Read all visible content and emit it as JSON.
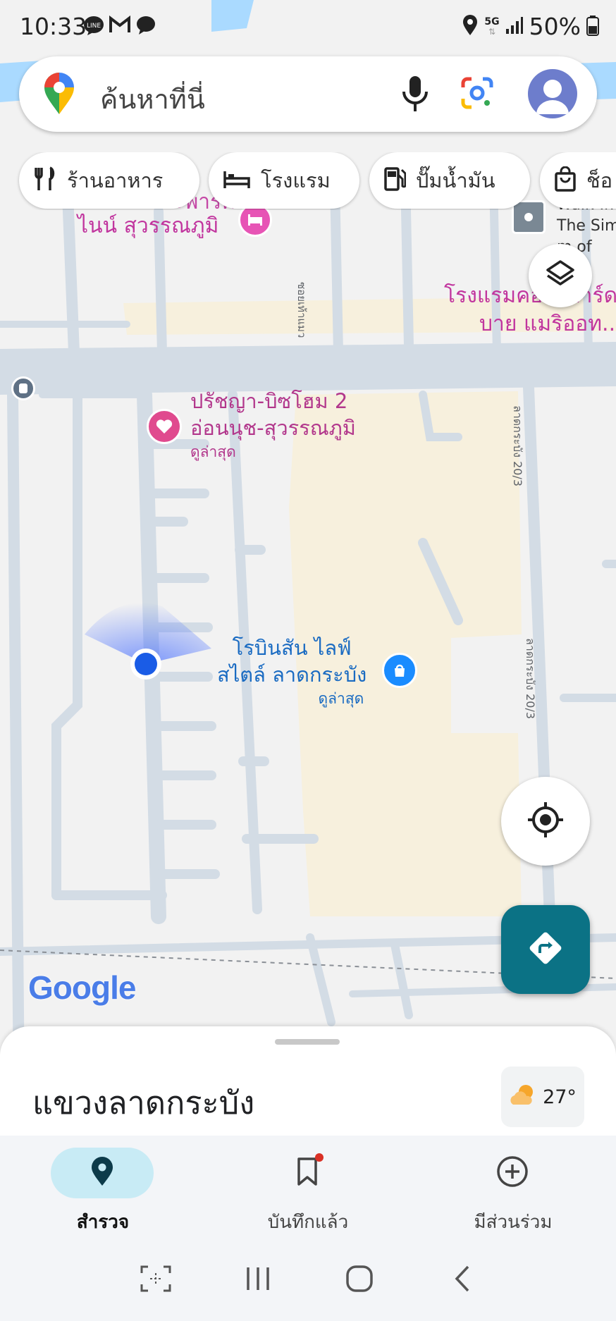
{
  "status_bar": {
    "time": "10:33",
    "battery_percent": "50%",
    "network": "5G",
    "app_icons": [
      "line-icon",
      "gmail-icon",
      "chat-icon"
    ]
  },
  "search": {
    "placeholder": "ค้นหาที่นี่"
  },
  "chips": [
    {
      "label": "ร้านอาหาร",
      "icon": "restaurant-icon"
    },
    {
      "label": "โรงแรม",
      "icon": "hotel-icon"
    },
    {
      "label": "ปั๊มน้ำมัน",
      "icon": "gas-station-icon"
    },
    {
      "label": "ช็อ",
      "icon": "shopping-bag-icon"
    }
  ],
  "map": {
    "place_labels": [
      {
        "line1": "โรงแรม เดอะพาร์ค",
        "line2": "ไนน์ สุวรรณภูมิ",
        "color": "#c1359e"
      },
      {
        "line1": "Walk-In",
        "line2": "The Sim",
        "line3": "m of",
        "color": "#333333"
      },
      {
        "line1": "โรงแรมคอร์ทยาร์ด",
        "line2": "บาย แมริออท...",
        "color": "#c1359e"
      },
      {
        "line1": "ปรัชญา-บิซโฮม 2",
        "line2": "อ่อนนุช-สุวรรณภูมิ",
        "sub": "ดูล่าสุด",
        "color": "#b2378c"
      },
      {
        "line1": "โรบินสัน ไลฟ์",
        "line2": "สไตล์ ลาดกระบัง",
        "sub": "ดูล่าสุด",
        "color": "#1a6bc2"
      }
    ],
    "street_labels": [
      "ซอยเท้าแมว",
      "ลาดกระบัง 20/3",
      "ลาดกระบัง 20/3"
    ],
    "google_logo": "Google",
    "colors": {
      "land": "#f2f2f2",
      "road": "#d3dce5",
      "commercial": "#f7f0dd",
      "water": "#aadaff",
      "hotel_pin": "#e754b5",
      "shop_pin": "#1a8cff",
      "location_dot": "#1a5ce6"
    }
  },
  "sheet": {
    "title": "แขวงลาดกระบัง",
    "weather_temp": "27°"
  },
  "bottom_nav": [
    {
      "label": "สำรวจ",
      "icon": "explore-pin-icon",
      "active": true
    },
    {
      "label": "บันทึกแล้ว",
      "icon": "bookmark-icon",
      "active": false
    },
    {
      "label": "มีส่วนร่วม",
      "icon": "add-circle-icon",
      "active": false
    }
  ],
  "accent_color": "#0b7285"
}
